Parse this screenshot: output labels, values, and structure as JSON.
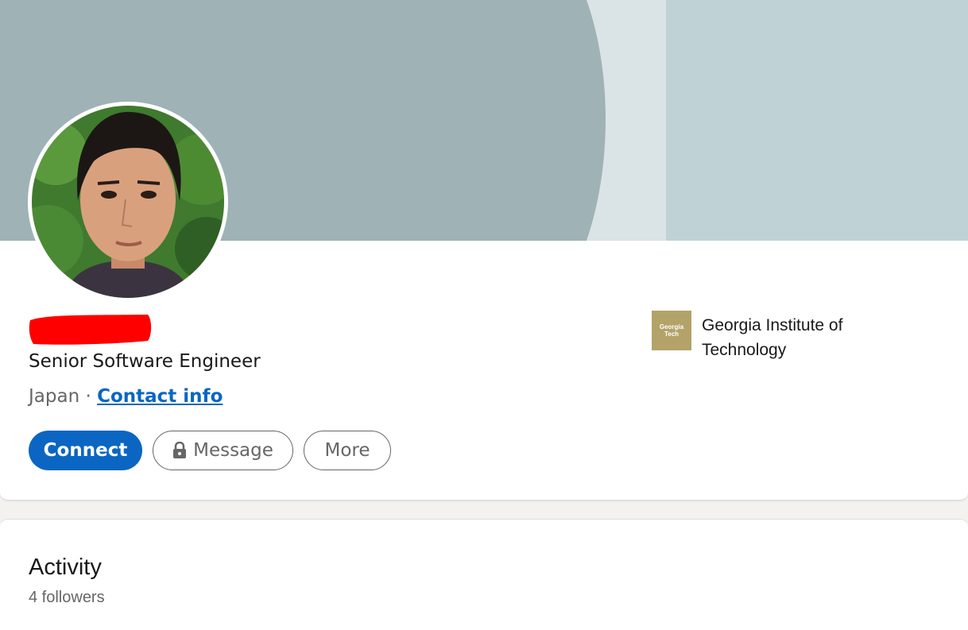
{
  "profile": {
    "headline": "Senior Software Engineer",
    "location": "Japan",
    "separator": " · ",
    "contact_info_label": "Contact info"
  },
  "actions": {
    "connect_label": "Connect",
    "message_label": "Message",
    "more_label": "More"
  },
  "education": {
    "school_name": "Georgia Institute of Technology",
    "logo_text_line1": "Georgia",
    "logo_text_line2": "Tech"
  },
  "activity": {
    "title": "Activity",
    "followers": "4 followers"
  },
  "colors": {
    "primary": "#0a66c2",
    "banner_dark": "#9fb2b5",
    "banner_light": "#dae4e7",
    "banner_right": "#bfd3d7",
    "redaction": "#ff0000",
    "school_logo": "#b3a369"
  },
  "icons": {
    "message_button": "lock-icon"
  }
}
